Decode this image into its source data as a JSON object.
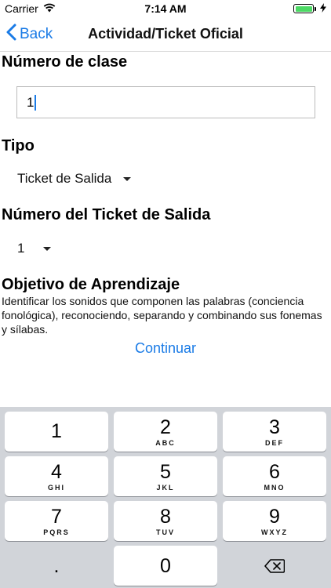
{
  "status_bar": {
    "carrier": "Carrier",
    "time": "7:14 AM"
  },
  "nav": {
    "back_label": "Back",
    "title": "Actividad/Ticket Oficial"
  },
  "form": {
    "class_number_label": "Número de clase",
    "class_number_value": "1",
    "type_label": "Tipo",
    "type_value": "Ticket de Salida",
    "ticket_number_label": "Número del Ticket de Salida",
    "ticket_number_value": "1",
    "objective_label": "Objetivo de Aprendizaje",
    "objective_text": "Identificar los sonidos que componen las palabras (conciencia fonológica), reconociendo, separando y combinando sus fonemas y sílabas.",
    "continue_label": "Continuar"
  },
  "keypad": {
    "keys": [
      {
        "digit": "1",
        "letters": ""
      },
      {
        "digit": "2",
        "letters": "ABC"
      },
      {
        "digit": "3",
        "letters": "DEF"
      },
      {
        "digit": "4",
        "letters": "GHI"
      },
      {
        "digit": "5",
        "letters": "JKL"
      },
      {
        "digit": "6",
        "letters": "MNO"
      },
      {
        "digit": "7",
        "letters": "PQRS"
      },
      {
        "digit": "8",
        "letters": "TUV"
      },
      {
        "digit": "9",
        "letters": "WXYZ"
      }
    ],
    "dot": ".",
    "zero": "0"
  },
  "colors": {
    "accent": "#1a7be6",
    "battery": "#4cd964",
    "keypad_bg": "#d1d4d9"
  },
  "icons": [
    "wifi-icon",
    "battery-icon",
    "charging-bolt-icon",
    "chevron-left-icon",
    "dropdown-triangle-icon",
    "backspace-icon"
  ]
}
